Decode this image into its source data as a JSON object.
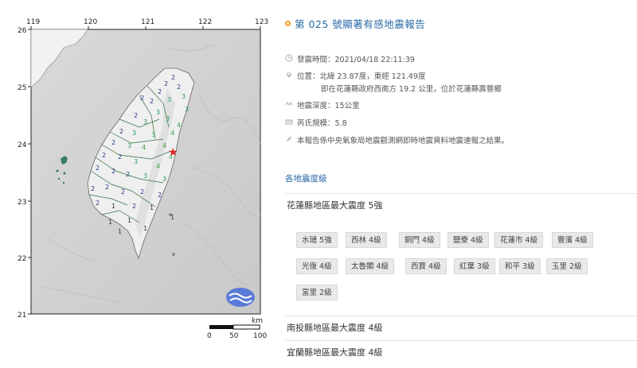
{
  "map": {
    "lon_ticks": [
      "119",
      "120",
      "121",
      "122",
      "123"
    ],
    "lat_ticks": [
      "26",
      "25",
      "24",
      "23",
      "22",
      "21"
    ],
    "scale_unit": "km",
    "scale_labels": [
      "0",
      "50",
      "100"
    ]
  },
  "report": {
    "title": "第 025 號顯著有感地震報告",
    "time": "發震時間：2021/04/18 22:11:39",
    "location_line1": "位置：北緯 23.87度，東經 121.49度",
    "location_line2": "即在花蓮縣政府西南方 19.2 公里，位於花蓮縣壽豐鄉",
    "depth": "地震深度：15公里",
    "magnitude": "芮氏規模：5.8",
    "note": "本報告係中央氣象局地震觀測網即時地震資料地震速報之結果。",
    "intensity_link": "各地震度級",
    "regions": [
      {
        "title": "花蓮縣地區最大震度 5強"
      },
      {
        "title": "南投縣地區最大震度 4級"
      },
      {
        "title": "宜蘭縣地區最大震度 4級"
      }
    ],
    "hualien_stations": [
      "水璉 5強",
      "西林 4級",
      "銅門 4級",
      "鹽寮 4級",
      "花蓮市 4級",
      "豐濱 4級",
      "光復 4級",
      "太魯閣 4級",
      "西寶 4級",
      "紅葉 3級",
      "和平 3級",
      "玉里 2級",
      "富里 2級"
    ]
  }
}
